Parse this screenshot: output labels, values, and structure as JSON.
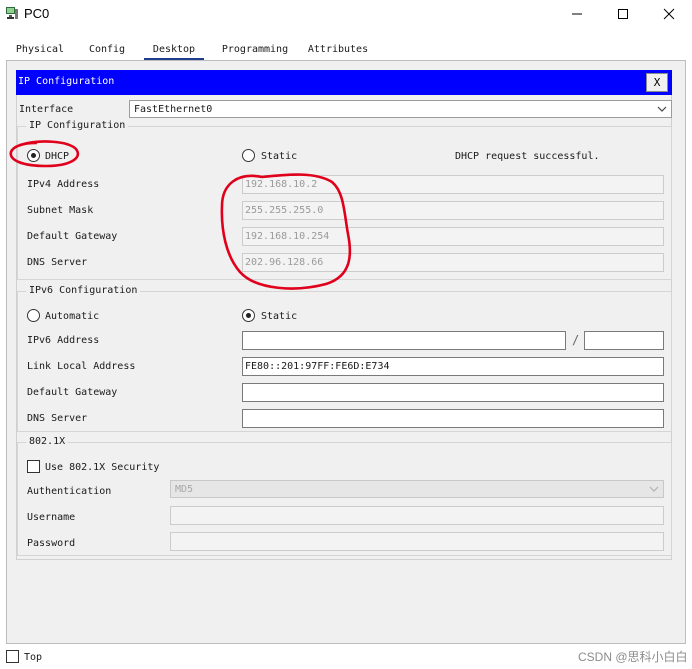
{
  "window": {
    "title": "PC0",
    "minimize_label": "—",
    "maximize_label": "☐",
    "close_label": "✕"
  },
  "tabs": [
    {
      "label": "Physical"
    },
    {
      "label": "Config"
    },
    {
      "label": "Desktop",
      "active": true
    },
    {
      "label": "Programming"
    },
    {
      "label": "Attributes"
    }
  ],
  "dialog": {
    "title": "IP Configuration",
    "close_label": "X",
    "interface_label": "Interface",
    "interface_value": "FastEthernet0"
  },
  "ipv4": {
    "group_title": "IP Configuration",
    "dhcp_label": "DHCP",
    "static_label": "Static",
    "mode": "DHCP",
    "status_text": "DHCP request successful.",
    "fields": [
      {
        "label": "IPv4 Address",
        "value": "192.168.10.2"
      },
      {
        "label": "Subnet Mask",
        "value": "255.255.255.0"
      },
      {
        "label": "Default Gateway",
        "value": "192.168.10.254"
      },
      {
        "label": "DNS Server",
        "value": "202.96.128.66"
      }
    ]
  },
  "ipv6": {
    "group_title": "IPv6 Configuration",
    "automatic_label": "Automatic",
    "static_label": "Static",
    "mode": "Static",
    "prefix_separator": "/",
    "fields": [
      {
        "label": "IPv6 Address",
        "value": "",
        "prefix": ""
      },
      {
        "label": "Link Local Address",
        "value": "FE80::201:97FF:FE6D:E734"
      },
      {
        "label": "Default Gateway",
        "value": ""
      },
      {
        "label": "DNS Server",
        "value": ""
      }
    ]
  },
  "dot1x": {
    "group_title": "802.1X",
    "use_label": "Use 802.1X Security",
    "use_checked": false,
    "auth_label": "Authentication",
    "auth_value": "MD5",
    "username_label": "Username",
    "username_value": "",
    "password_label": "Password",
    "password_value": ""
  },
  "footer": {
    "top_label": "Top",
    "top_checked": false,
    "watermark": "CSDN @思科小白白"
  },
  "annotation": {
    "color": "#e0001b"
  },
  "colors": {
    "dialog_header": "#0000ff",
    "panel_bg": "#f0f0f0",
    "active_tab_underline": "#1e3d8f"
  }
}
